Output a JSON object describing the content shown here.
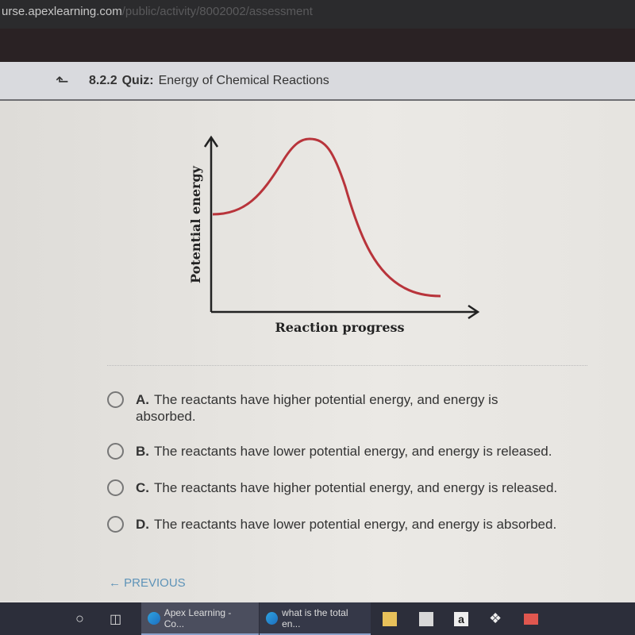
{
  "browser": {
    "url_host": "urse.apexlearning.com",
    "url_path": "/public/activity/8002002/assessment"
  },
  "header": {
    "back_icon": "back-up-arrow-icon",
    "number": "8.2.2",
    "quiz_label": "Quiz:",
    "title": "Energy of Chemical Reactions"
  },
  "diagram": {
    "y_axis_label": "Potential energy",
    "x_axis_label": "Reaction progress",
    "curve_color": "#b8343b"
  },
  "options": [
    {
      "letter": "A.",
      "text": "The reactants have higher potential energy, and energy is absorbed."
    },
    {
      "letter": "B.",
      "text": "The reactants have lower potential energy, and energy is released."
    },
    {
      "letter": "C.",
      "text": "The reactants have higher potential energy, and energy is released."
    },
    {
      "letter": "D.",
      "text": "The reactants have lower potential energy, and energy is absorbed."
    }
  ],
  "nav": {
    "previous_label": "PREVIOUS"
  },
  "taskbar": {
    "tasks": [
      {
        "label": "Apex Learning - Co..."
      },
      {
        "label": "what is the total en..."
      }
    ],
    "amazon_glyph": "a"
  }
}
